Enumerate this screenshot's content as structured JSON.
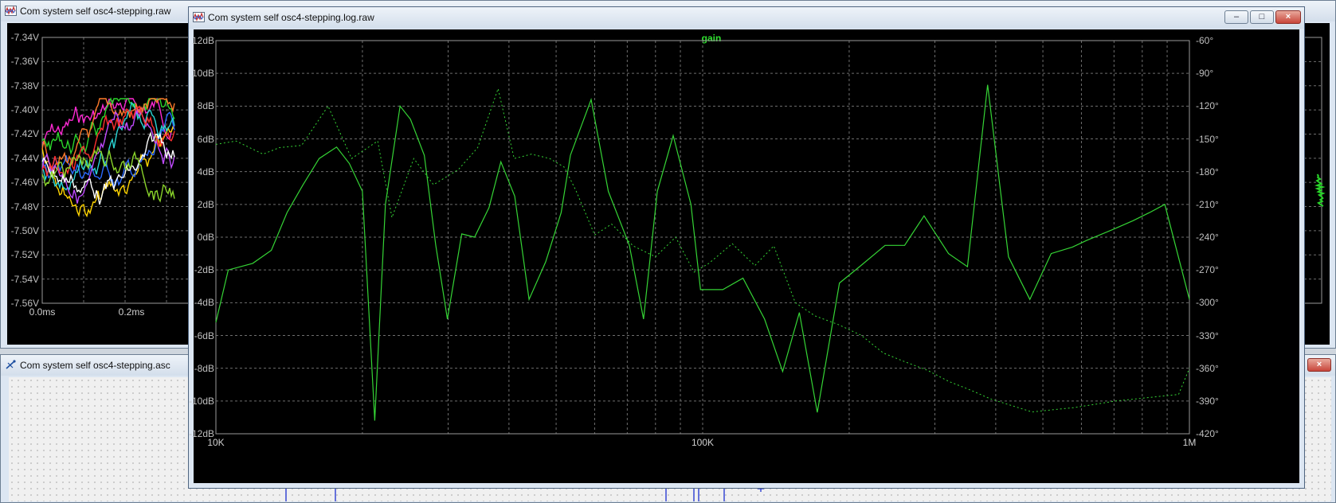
{
  "windows": {
    "transient": {
      "title": "Com system self osc4-stepping.raw",
      "y_ticks": [
        "-7.34V",
        "-7.36V",
        "-7.38V",
        "-7.40V",
        "-7.42V",
        "-7.44V",
        "-7.46V",
        "-7.48V",
        "-7.50V",
        "-7.52V",
        "-7.54V",
        "-7.56V"
      ],
      "x_ticks": [
        "0.0ms",
        "0.2ms"
      ]
    },
    "schematic": {
      "title": "Com system self osc4-stepping.asc"
    },
    "bode": {
      "title": "Com system self osc4-stepping.log.raw",
      "buttons": {
        "minimize": "–",
        "maximize": "□",
        "close": "×"
      }
    }
  },
  "chart_data": {
    "type": "line",
    "title": "gain",
    "x_scale": "log",
    "xlim": [
      10000,
      1000000
    ],
    "x_ticks": [
      "10K",
      "100K",
      "1M"
    ],
    "y_left_ticks": [
      "12dB",
      "10dB",
      "8dB",
      "6dB",
      "4dB",
      "2dB",
      "0dB",
      "-2dB",
      "-4dB",
      "-6dB",
      "-8dB",
      "-10dB",
      "-12dB"
    ],
    "y_right_ticks": [
      "-60°",
      "-90°",
      "-120°",
      "-150°",
      "-180°",
      "-210°",
      "-240°",
      "-270°",
      "-300°",
      "-330°",
      "-360°",
      "-390°",
      "-420°"
    ],
    "ylim_left": [
      -12,
      12
    ],
    "ylim_right": [
      -420,
      -60
    ],
    "grid": true,
    "colors": {
      "gain": "#35d435",
      "phase": "#35d435",
      "title": "#2fe02f",
      "background": "#000000",
      "grid": "#6e6e6e"
    },
    "series": [
      {
        "name": "gain",
        "style": "solid",
        "x": [
          10000,
          10600,
          11900,
          13000,
          14000,
          15100,
          16300,
          17700,
          18800,
          20000,
          21200,
          22300,
          23900,
          25100,
          26800,
          28300,
          29900,
          32000,
          34000,
          36400,
          38500,
          41100,
          44000,
          47600,
          51200,
          53500,
          59000,
          64000,
          70700,
          75600,
          80700,
          87000,
          94600,
          99000,
          110000,
          121000,
          134000,
          146000,
          158000,
          172000,
          191000,
          210000,
          237000,
          260000,
          285000,
          320000,
          350000,
          385000,
          425000,
          470000,
          520000,
          575000,
          615000,
          700000,
          765000,
          828000,
          890000,
          1000000
        ],
        "y": [
          -5.2,
          -2.0,
          -1.6,
          -0.8,
          1.5,
          3.2,
          4.8,
          5.5,
          4.5,
          2.8,
          -11.2,
          2.0,
          8.0,
          7.2,
          5.0,
          -0.5,
          -5.0,
          0.2,
          0.0,
          1.8,
          4.6,
          2.5,
          -3.8,
          -1.5,
          1.5,
          5.0,
          8.4,
          2.8,
          -0.5,
          -5.0,
          2.8,
          6.2,
          2.0,
          -3.2,
          -3.2,
          -2.5,
          -5.0,
          -8.2,
          -4.6,
          -10.7,
          -2.8,
          -1.8,
          -0.5,
          -0.5,
          1.3,
          -1.0,
          -1.8,
          9.3,
          -1.2,
          -3.8,
          -1.0,
          -0.6,
          -0.2,
          0.5,
          1.0,
          1.5,
          2.0,
          -3.8
        ]
      },
      {
        "name": "phase",
        "style": "dotted",
        "x": [
          10000,
          11000,
          12500,
          13500,
          15000,
          17000,
          19000,
          21500,
          23000,
          25500,
          28000,
          31500,
          34500,
          38000,
          41000,
          44500,
          48500,
          52000,
          55000,
          60000,
          65000,
          72000,
          80000,
          88000,
          96000,
          103000,
          115000,
          128000,
          140000,
          155000,
          170000,
          190000,
          212000,
          235000,
          260000,
          290000,
          320000,
          355000,
          390000,
          430000,
          475000,
          525000,
          580000,
          640000,
          705000,
          780000,
          860000,
          950000,
          1000000
        ],
        "y": [
          -155,
          -152,
          -164,
          -158,
          -156,
          -120,
          -168,
          -152,
          -222,
          -168,
          -192,
          -178,
          -158,
          -104,
          -168,
          -164,
          -168,
          -176,
          -198,
          -238,
          -228,
          -248,
          -258,
          -240,
          -272,
          -264,
          -246,
          -266,
          -248,
          -300,
          -312,
          -320,
          -330,
          -346,
          -354,
          -362,
          -372,
          -380,
          -388,
          -394,
          -400,
          -398,
          -396,
          -393,
          -390,
          -388,
          -386,
          -384,
          -360
        ]
      }
    ]
  }
}
